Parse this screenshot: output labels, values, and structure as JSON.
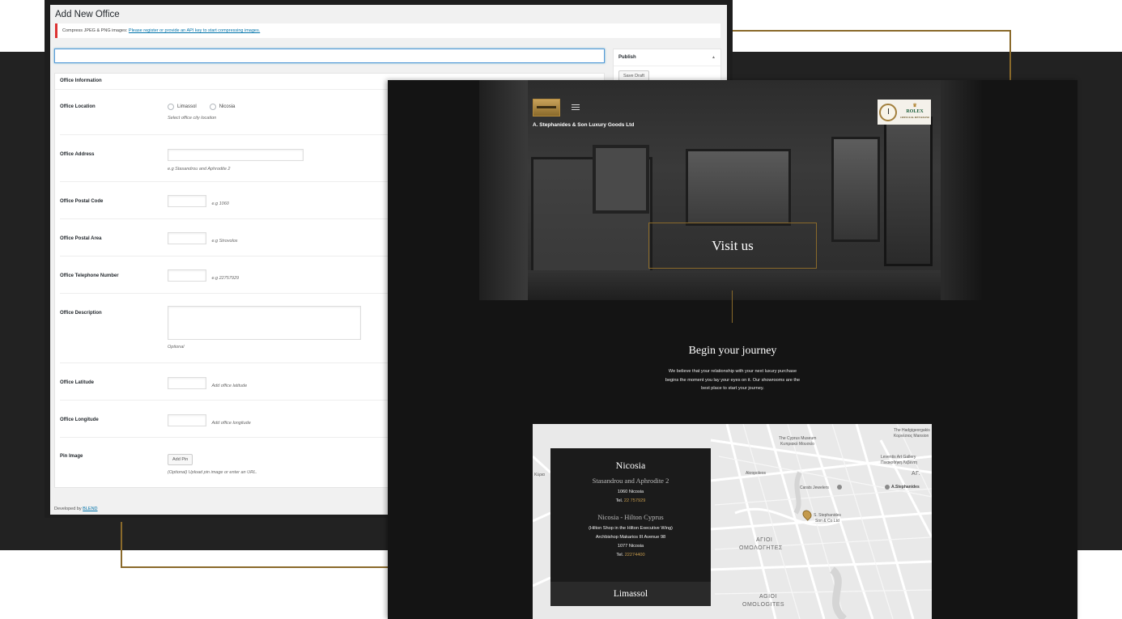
{
  "admin": {
    "title": "Add New Office",
    "notice_text": "Compress JPEG & PNG images:",
    "notice_link": "Please register or provide an API key to start compressing images.",
    "publish_label": "Publish",
    "publish_arrow": "▲",
    "save_draft": "Save Draft",
    "box_title": "Office Information",
    "fields": {
      "location_label": "Office Location",
      "location_options": [
        "Limassol",
        "Nicosia"
      ],
      "location_hint": "Select office city location",
      "address_label": "Office Address",
      "address_hint": "e.g Stasandrou and Aphrodite 2",
      "postal_code_label": "Office Postal Code",
      "postal_code_hint": "e.g 1060",
      "postal_area_label": "Office Postal Area",
      "postal_area_hint": "e.g Strovolos",
      "telephone_label": "Office Telephone Number",
      "telephone_hint": "e.g 22757929",
      "description_label": "Office Description",
      "description_hint": "Optional",
      "latitude_label": "Office Latitude",
      "latitude_hint": "Add office latitude",
      "longitude_label": "Office Longitude",
      "longitude_hint": "Add office longitude",
      "pin_label": "Pin Image",
      "pin_button": "Add Pin",
      "pin_hint": "(Optional) Upload pin image or enter an URL."
    },
    "footer_text": "Developed by",
    "footer_link": "BLEND"
  },
  "site": {
    "brand": "A. Stephanides & Son Luxury Goods Ltd",
    "rolex": "ROLEX",
    "rolex_sub": "OFFICIAL RETAILER",
    "hero_title": "Visit us",
    "journey_title": "Begin your journey",
    "journey_text": "We believe that your relationship with your next luxury purchase begins the moment you lay your eyes on it. Our showrooms are the best place to start your journey.",
    "card": {
      "city": "Nicosia",
      "address_1": "Stasandrou and Aphrodite 2",
      "postal_1": "1060 Nicosia",
      "tel_prefix": "Tel.",
      "tel_1": "22 757929",
      "address_2_title": "Nicosia - Hilton Cyprus",
      "address_2_line1": "(Hilton Shop in the Hilton Executive Wing)",
      "address_2_line2": "Archbishop Makarios III Avenue 98",
      "postal_2": "1077 Nicosia",
      "tel_2": "22274400"
    },
    "limassol": "Limassol",
    "map_labels": {
      "museum": "The Cyprus Museum",
      "museum_gr": "Κυπριακό Μουσείο",
      "leventis": "Leventis Art Gallery",
      "leventis_gr": "Πινακοθήκη Λεβέντη",
      "carats": "Carats Jewelers",
      "stephanides": "A.Stephanides",
      "son_co_1": "S. Stephanides",
      "son_co_2": "Son & Co Ltd",
      "agioi_1": "ΑΓΙΟΙ",
      "agioi_2": "ΟΜΟΛΟΓΗΤΕΣ",
      "agioi_3": "AGIOI",
      "agioi_4": "OMOLOGITES",
      "ag": "ΑΓ.",
      "geograph": "The Hadgigeorgakis",
      "geograph_2": "Κορνέσιος Mansion",
      "akropoleos": "Akropoleos",
      "kyria": "Κύρια"
    }
  }
}
